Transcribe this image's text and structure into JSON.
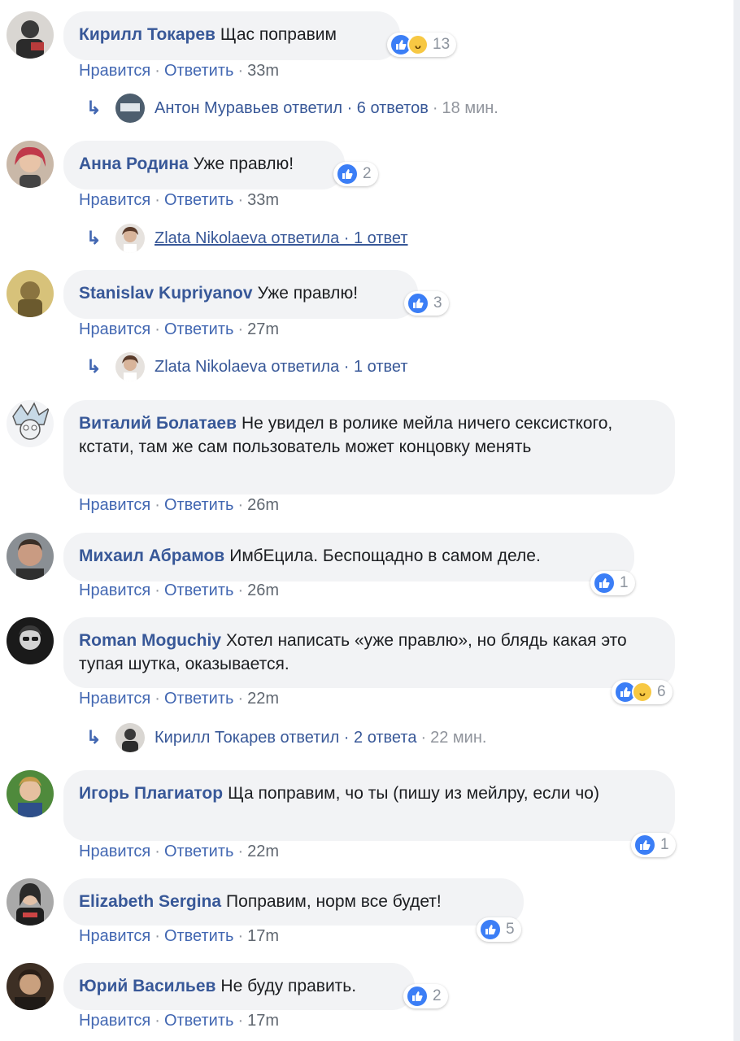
{
  "separator": "·",
  "comments": [
    {
      "author": "Кирилл Токарев",
      "text": "Щас поправим",
      "like": "Нравится",
      "reply": "Ответить",
      "time": "33m",
      "reactions": {
        "count": "13",
        "types": [
          "like-icon",
          "haha-icon"
        ]
      },
      "replies": {
        "text": "Антон Муравьев ответил · 6 ответов",
        "time": "18 мин."
      }
    },
    {
      "author": "Анна Родина",
      "text": "Уже правлю!",
      "like": "Нравится",
      "reply": "Ответить",
      "time": "33m",
      "reactions": {
        "count": "2",
        "types": [
          "like-icon"
        ]
      },
      "replies": {
        "text": "Zlata Nikolaeva ответила · 1 ответ",
        "time": ""
      }
    },
    {
      "author": "Stanislav Kupriyanov",
      "text": "Уже правлю!",
      "like": "Нравится",
      "reply": "Ответить",
      "time": "27m",
      "reactions": {
        "count": "3",
        "types": [
          "like-icon"
        ]
      },
      "replies": {
        "text": "Zlata Nikolaeva ответила · 1 ответ",
        "time": ""
      }
    },
    {
      "author": "Виталий Болатаев",
      "text": "Не увидел в ролике мейла ничего сексисткого, кстати, там же сам пользователь может концовку менять",
      "like": "Нравится",
      "reply": "Ответить",
      "time": "26m"
    },
    {
      "author": "Михаил Абрамов",
      "text": "ИмбЕцила. Беспощадно в самом деле.",
      "like": "Нравится",
      "reply": "Ответить",
      "time": "26m",
      "reactions": {
        "count": "1",
        "types": [
          "like-icon"
        ]
      }
    },
    {
      "author": "Roman Moguchiy",
      "text": "Хотел написать «уже правлю», но блядь какая это тупая шутка, оказывается.",
      "like": "Нравится",
      "reply": "Ответить",
      "time": "22m",
      "reactions": {
        "count": "6",
        "types": [
          "like-icon",
          "haha-icon"
        ]
      },
      "replies": {
        "text": "Кирилл Токарев ответил · 2 ответа",
        "time": "22 мин."
      }
    },
    {
      "author": "Игорь Плагиатор",
      "text": "Ща поправим, чо ты (пишу из мейлру, если чо)",
      "like": "Нравится",
      "reply": "Ответить",
      "time": "22m",
      "reactions": {
        "count": "1",
        "types": [
          "like-icon"
        ]
      }
    },
    {
      "author": "Elizabeth Sergina",
      "text": "Поправим, норм все будет!",
      "like": "Нравится",
      "reply": "Ответить",
      "time": "17m",
      "reactions": {
        "count": "5",
        "types": [
          "like-icon"
        ]
      }
    },
    {
      "author": "Юрий Васильев",
      "text": "Не буду править.",
      "like": "Нравится",
      "reply": "Ответить",
      "time": "17m",
      "reactions": {
        "count": "2",
        "types": [
          "like-icon"
        ]
      }
    }
  ],
  "colors": {
    "author": "#385898",
    "action": "#4267b2",
    "bubble": "#f2f3f5",
    "like": "#3b7ef6",
    "haha": "#f7c843"
  }
}
